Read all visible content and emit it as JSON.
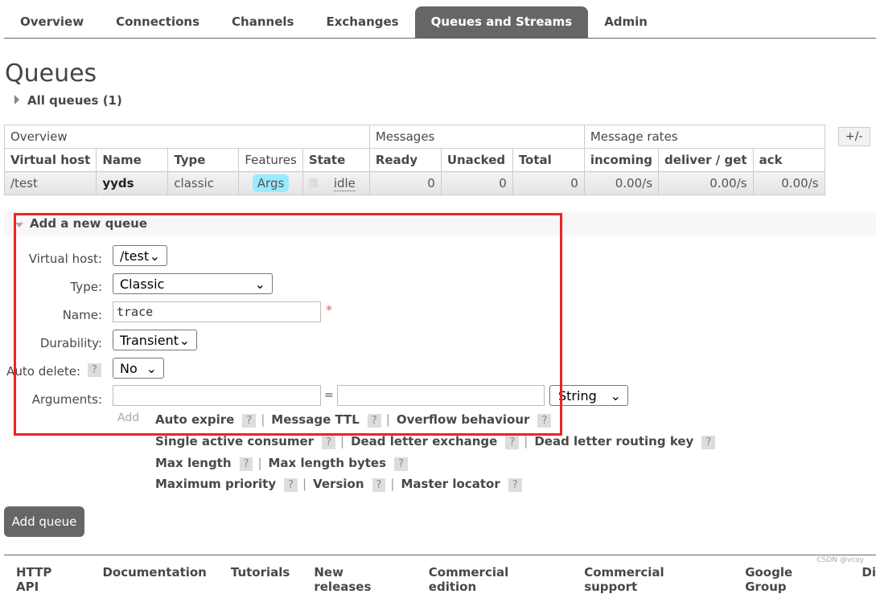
{
  "nav": [
    "Overview",
    "Connections",
    "Channels",
    "Exchanges",
    "Queues and Streams",
    "Admin"
  ],
  "title": "Queues",
  "all_queues": "All queues (1)",
  "table": {
    "groups": [
      "Overview",
      "Messages",
      "Message rates"
    ],
    "headers": [
      "Virtual host",
      "Name",
      "Type",
      "Features",
      "State",
      "Ready",
      "Unacked",
      "Total",
      "incoming",
      "deliver / get",
      "ack"
    ],
    "row": {
      "vhost": "/test",
      "name": "yyds",
      "type": "classic",
      "features": "Args",
      "state": "idle",
      "ready": "0",
      "unacked": "0",
      "total": "0",
      "incoming": "0.00/s",
      "deliver": "0.00/s",
      "ack": "0.00/s"
    },
    "toggle": "+/-"
  },
  "form": {
    "section": "Add a new queue",
    "vhost_label": "Virtual host:",
    "vhost": "/test",
    "type_label": "Type:",
    "type": "Classic",
    "name_label": "Name:",
    "name": "trace",
    "required": "*",
    "durability_label": "Durability:",
    "durability": "Transient",
    "autodelete_label": "Auto delete:",
    "autodelete": "No",
    "arguments_label": "Arguments:",
    "eq": "=",
    "arg_type": "String",
    "add": "Add",
    "help": "?",
    "arg_links": [
      [
        "Auto expire",
        "Message TTL",
        "Overflow behaviour"
      ],
      [
        "Single active consumer",
        "Dead letter exchange",
        "Dead letter routing key"
      ],
      [
        "Max length",
        "Max length bytes"
      ],
      [
        "Maximum priority",
        "Version",
        "Master locator"
      ]
    ],
    "sep": "|",
    "submit": "Add queue"
  },
  "footer": [
    "HTTP API",
    "Documentation",
    "Tutorials",
    "New releases",
    "Commercial edition",
    "Commercial support",
    "Google Group",
    "Di"
  ],
  "watermark": "CSDN @vcoy"
}
